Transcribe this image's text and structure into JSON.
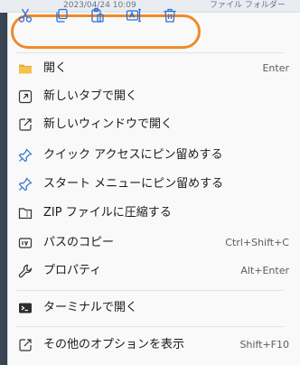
{
  "background": {
    "date_text": "2023/04/24 10:09",
    "type_text": "ファイル フォルダー"
  },
  "toolbar": {
    "items": [
      {
        "name": "cut",
        "icon": "scissors-icon"
      },
      {
        "name": "copy",
        "icon": "copy-icon"
      },
      {
        "name": "paste",
        "icon": "clipboard-icon"
      },
      {
        "name": "rename",
        "icon": "rename-icon"
      },
      {
        "name": "delete",
        "icon": "trash-icon"
      }
    ],
    "highlight_color": "#f08a2b",
    "icon_color": "#2b6fd6"
  },
  "menu": {
    "items": [
      {
        "label": "開く",
        "shortcut": "Enter",
        "icon": "folder-icon"
      },
      {
        "label": "新しいタブで開く",
        "shortcut": "",
        "icon": "new-tab-icon"
      },
      {
        "label": "新しいウィンドウで開く",
        "shortcut": "",
        "icon": "new-window-icon"
      },
      {
        "label": "クイック アクセスにピン留めする",
        "shortcut": "",
        "icon": "pin-icon"
      },
      {
        "label": "スタート メニューにピン留めする",
        "shortcut": "",
        "icon": "pin-icon"
      },
      {
        "label": "ZIP ファイルに圧縮する",
        "shortcut": "",
        "icon": "zip-icon"
      },
      {
        "label": "パスのコピー",
        "shortcut": "Ctrl+Shift+C",
        "icon": "copy-path-icon"
      },
      {
        "label": "プロパティ",
        "shortcut": "Alt+Enter",
        "icon": "wrench-icon"
      },
      {
        "label": "ターミナルで開く",
        "shortcut": "",
        "icon": "terminal-icon"
      },
      {
        "label": "その他のオプションを表示",
        "shortcut": "Shift+F10",
        "icon": "more-options-icon"
      }
    ]
  }
}
